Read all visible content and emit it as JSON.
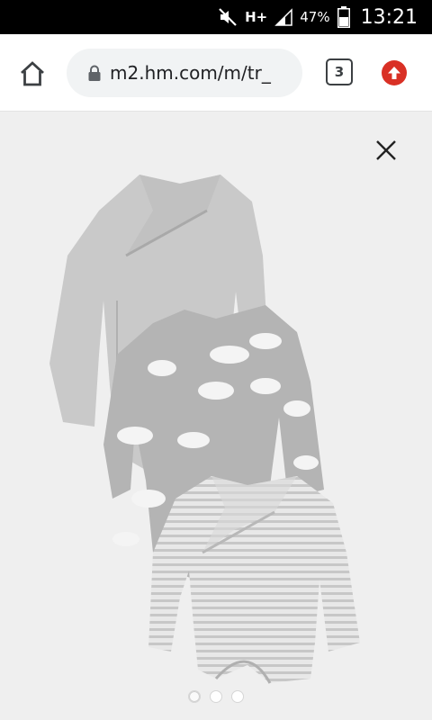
{
  "status_bar": {
    "network": "H+",
    "battery": "47%",
    "time": "13:21"
  },
  "browser": {
    "url": "m2.hm.com/m/tr_",
    "tab_count": "3"
  },
  "product": {
    "image_icon": "baby-bodysuits-three-pack-image"
  },
  "carousel": {
    "total": 3,
    "active_index": 0
  },
  "colors": {
    "update_badge": "#d93025",
    "background": "#efefef"
  }
}
